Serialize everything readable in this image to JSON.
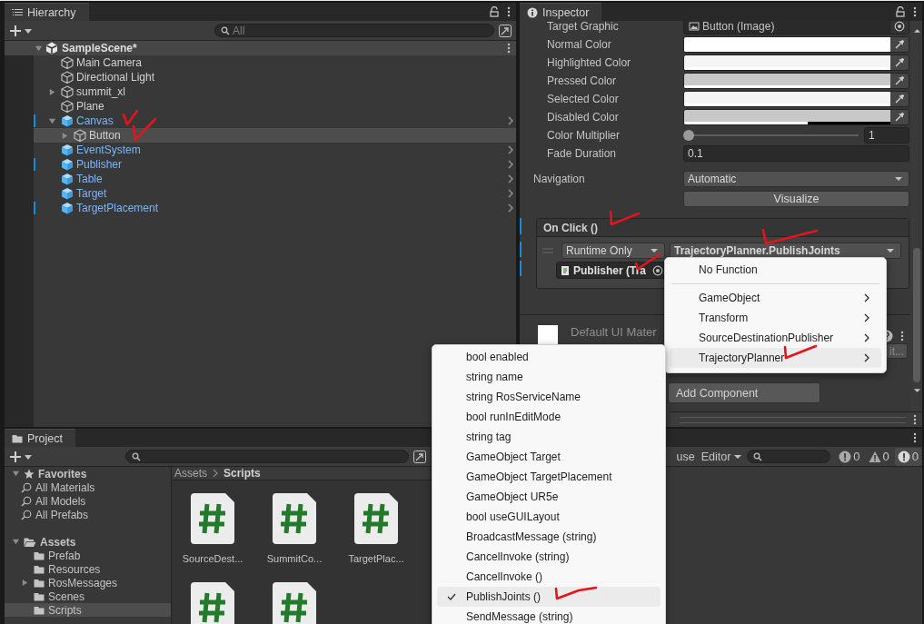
{
  "hierarchy": {
    "title": "Hierarchy",
    "search": {
      "placeholder": "All"
    },
    "scene": {
      "name": "SampleScene*",
      "expanded": true,
      "children": [
        {
          "name": "Main Camera",
          "prefab": false,
          "selected": false,
          "overridden": false
        },
        {
          "name": "Directional Light",
          "prefab": false,
          "selected": false,
          "overridden": false
        },
        {
          "name": "summit_xl",
          "prefab": false,
          "expanded": false,
          "selected": false,
          "overridden": false
        },
        {
          "name": "Plane",
          "prefab": false,
          "selected": false,
          "overridden": false
        },
        {
          "name": "Canvas",
          "prefab": true,
          "expanded": true,
          "selected": false,
          "overridden": true,
          "children": [
            {
              "name": "Button",
              "prefab": false,
              "expanded": false,
              "selected": true,
              "overridden": false
            }
          ]
        },
        {
          "name": "EventSystem",
          "prefab": true,
          "selected": false,
          "overridden": false
        },
        {
          "name": "Publisher",
          "prefab": true,
          "selected": false,
          "overridden": true
        },
        {
          "name": "Table",
          "prefab": true,
          "selected": false,
          "overridden": false
        },
        {
          "name": "Target",
          "prefab": true,
          "selected": false,
          "overridden": false
        },
        {
          "name": "TargetPlacement",
          "prefab": true,
          "selected": false,
          "overridden": true
        }
      ]
    }
  },
  "inspector": {
    "title": "Inspector",
    "target_graphic": {
      "label": "Target Graphic",
      "value": "Button (Image)"
    },
    "colors": [
      {
        "label": "Normal Color",
        "color": "#ffffff",
        "level": 1
      },
      {
        "label": "Highlighted Color",
        "color": "#f5f5f5",
        "level": 1
      },
      {
        "label": "Pressed Color",
        "color": "#c8c8c8",
        "level": 1
      },
      {
        "label": "Selected Color",
        "color": "#f5f5f5",
        "level": 1
      },
      {
        "label": "Disabled Color",
        "color": "#c8c8c8",
        "level": 0.6
      }
    ],
    "color_multiplier": {
      "label": "Color Multiplier",
      "level": 0,
      "value": "1"
    },
    "fade_duration": {
      "label": "Fade Duration",
      "value": "0.1"
    },
    "navigation": {
      "label": "Navigation",
      "value": "Automatic"
    },
    "visualize": "Visualize",
    "on_click": {
      "title": "On Click ()",
      "overridden": true,
      "mode": "Runtime Only",
      "function": "TrajectoryPlanner.PublishJoints",
      "target": "Publisher (Tra"
    },
    "material": {
      "name": "Default UI Mater",
      "edit": "it..."
    },
    "add_component": "Add Component"
  },
  "component_menu": {
    "items": [
      {
        "kind": "item",
        "label": "No Function",
        "selected": false
      },
      {
        "kind": "separator"
      },
      {
        "kind": "submenu",
        "label": "GameObject",
        "selected": false
      },
      {
        "kind": "submenu",
        "label": "Transform",
        "selected": false
      },
      {
        "kind": "submenu",
        "label": "SourceDestinationPublisher",
        "selected": false
      },
      {
        "kind": "submenu",
        "label": "TrajectoryPlanner",
        "selected": true
      }
    ]
  },
  "function_menu": {
    "items": [
      {
        "label": "bool enabled",
        "checked": false,
        "selected": false
      },
      {
        "label": "string name",
        "checked": false,
        "selected": false
      },
      {
        "label": "string RosServiceName",
        "checked": false,
        "selected": false
      },
      {
        "label": "bool runInEditMode",
        "checked": false,
        "selected": false
      },
      {
        "label": "string tag",
        "checked": false,
        "selected": false
      },
      {
        "label": "GameObject Target",
        "checked": false,
        "selected": false
      },
      {
        "label": "GameObject TargetPlacement",
        "checked": false,
        "selected": false
      },
      {
        "label": "GameObject UR5e",
        "checked": false,
        "selected": false
      },
      {
        "label": "bool useGUILayout",
        "checked": false,
        "selected": false
      },
      {
        "label": "BroadcastMessage (string)",
        "checked": false,
        "selected": false
      },
      {
        "label": "CancelInvoke (string)",
        "checked": false,
        "selected": false
      },
      {
        "label": "CancelInvoke ()",
        "checked": false,
        "selected": false
      },
      {
        "label": "PublishJoints ()",
        "checked": true,
        "selected": true
      },
      {
        "label": "SendMessage (string)",
        "checked": false,
        "selected": false
      }
    ]
  },
  "project": {
    "title": "Project",
    "favorites": {
      "label": "Favorites",
      "expanded": true,
      "children": [
        {
          "label": "All Materials"
        },
        {
          "label": "All Models"
        },
        {
          "label": "All Prefabs"
        }
      ]
    },
    "assets": {
      "label": "Assets",
      "expanded": true,
      "children": [
        {
          "label": "Prefab",
          "selected": false
        },
        {
          "label": "Resources",
          "selected": false
        },
        {
          "label": "RosMessages",
          "expanded": false,
          "selected": false
        },
        {
          "label": "Scenes",
          "selected": false
        },
        {
          "label": "Scripts",
          "selected": true
        }
      ]
    },
    "breadcrumb": [
      "Assets",
      "Scripts"
    ],
    "files": [
      {
        "kind": "script",
        "name": "SourceDest..."
      },
      {
        "kind": "script",
        "name": "SummitCo..."
      },
      {
        "kind": "script",
        "name": "TargetPlac..."
      },
      {
        "kind": "script"
      },
      {
        "kind": "script"
      }
    ]
  },
  "console": {
    "pause_label": "use",
    "source": "Editor",
    "counts": [
      {
        "kind": "info",
        "value": "0"
      },
      {
        "kind": "warning",
        "value": "0"
      },
      {
        "kind": "error",
        "value": "0"
      }
    ]
  }
}
